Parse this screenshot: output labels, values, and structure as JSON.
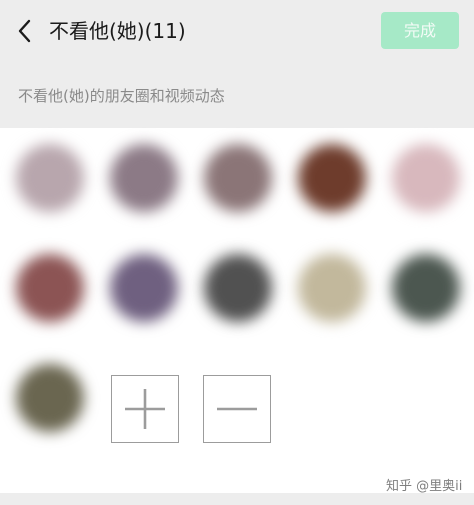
{
  "header": {
    "title": "不看他(她)(11)",
    "done_label": "完成",
    "done_color": "#a6e9c7"
  },
  "subtitle": "不看他(她)的朋友圈和视频动态",
  "members": [
    {
      "color": "#b8a6ad"
    },
    {
      "color": "#8c7a86"
    },
    {
      "color": "#8b7577"
    },
    {
      "color": "#6e3c2c"
    },
    {
      "color": "#d8b8bd"
    },
    {
      "color": "#8c5454"
    },
    {
      "color": "#6f6080"
    },
    {
      "color": "#515151"
    },
    {
      "color": "#c2b89c"
    },
    {
      "color": "#4c5750"
    },
    {
      "color": "#6a6650"
    }
  ],
  "controls": {
    "add_icon": "plus-icon",
    "remove_icon": "minus-icon"
  },
  "watermark": "知乎 @里奥ii"
}
